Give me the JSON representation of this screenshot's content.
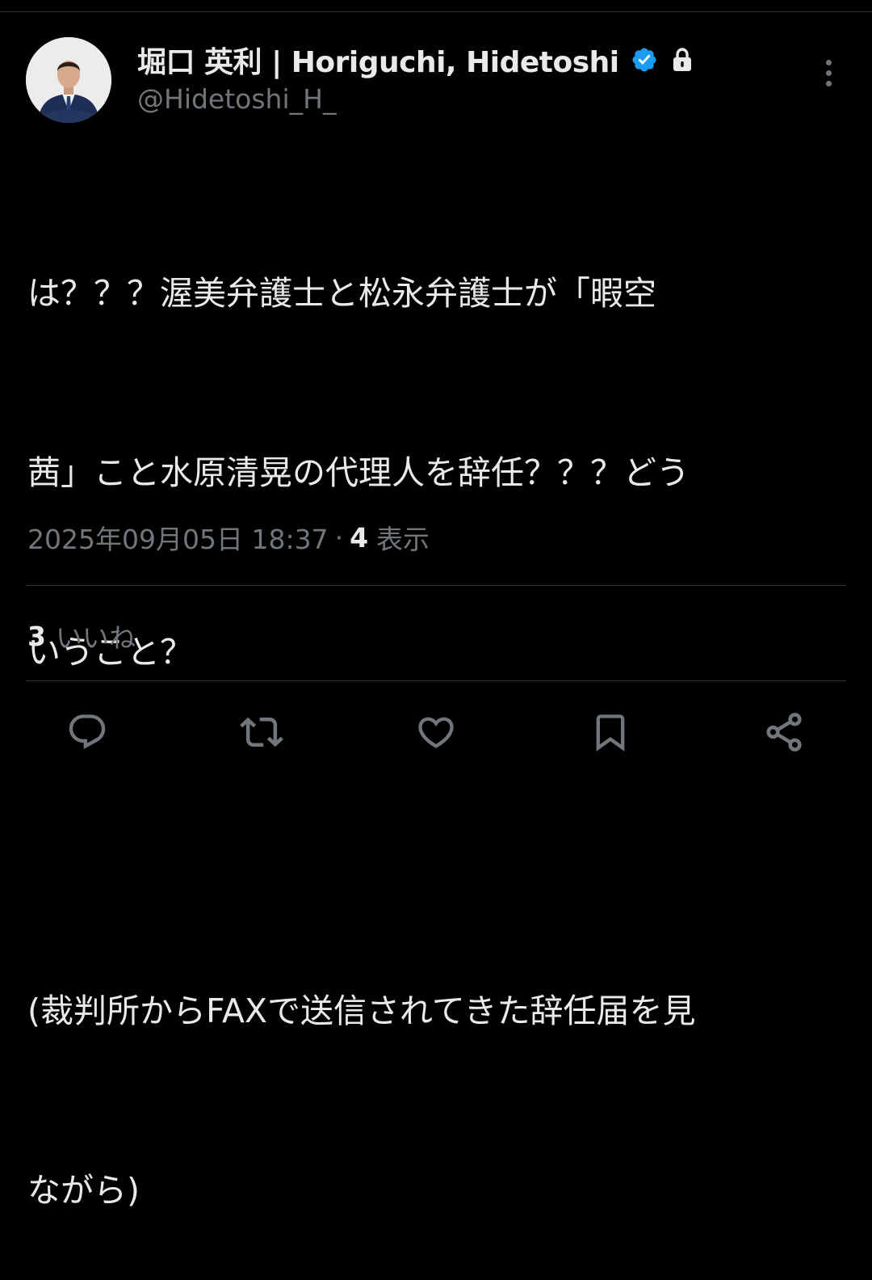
{
  "author": {
    "display_name": "堀口 英利 | Horiguchi, Hidetoshi",
    "handle": "@Hidetoshi_H_",
    "verified": true,
    "protected": true,
    "verified_color": "#1d9bf0"
  },
  "tweet": {
    "lines": [
      "は？？？渥美弁護士と松永弁護士が「暇空",
      "茜」こと水原清晃の代理人を辞任？？？どう",
      "いうこと？",
      "",
      "(裁判所からFAXで送信されてきた辞任届を見",
      "ながら)"
    ]
  },
  "meta": {
    "timestamp": "2025年09月05日 18:37",
    "separator": "·",
    "views_count": "4",
    "views_label": "表示"
  },
  "engagement": {
    "likes_count": "3",
    "likes_label": "いいね"
  },
  "actions": {
    "icons": [
      "reply-icon",
      "retweet-icon",
      "like-icon",
      "bookmark-icon",
      "share-icon"
    ]
  },
  "colors": {
    "background": "#000000",
    "text_primary": "#e7e9ea",
    "text_secondary": "#71767b",
    "divider": "#2f3336"
  }
}
